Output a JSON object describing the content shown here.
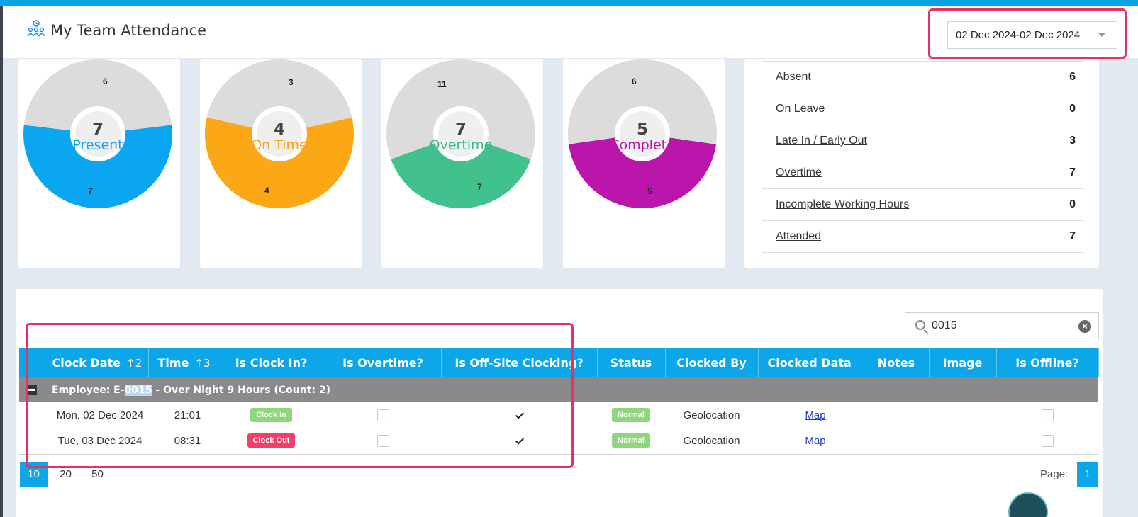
{
  "header": {
    "title": "My Team Attendance",
    "date_range": "02 Dec 2024-02 Dec 2024"
  },
  "donuts": [
    {
      "name": "present",
      "center_value": "7",
      "center_label": "Present",
      "color": "#0aa7f0",
      "segment_value": "7",
      "remainder_value": "6",
      "fraction": 0.538
    },
    {
      "name": "on-time",
      "center_value": "4",
      "center_label": "On Time",
      "color": "#fca816",
      "segment_value": "4",
      "remainder_value": "3",
      "fraction": 0.571
    },
    {
      "name": "overtime",
      "center_value": "7",
      "center_label": "Overtime",
      "color": "#41c18d",
      "segment_value": "7",
      "remainder_value": "11",
      "fraction": 0.389
    },
    {
      "name": "complete",
      "center_value": "5",
      "center_label": "Complete",
      "color": "#bb16ab",
      "segment_value": "5",
      "remainder_value": "6",
      "fraction": 0.455
    }
  ],
  "stats": [
    {
      "label": "Absent",
      "value": "6"
    },
    {
      "label": "On Leave",
      "value": "0"
    },
    {
      "label": "Late In / Early Out",
      "value": "3"
    },
    {
      "label": "Overtime",
      "value": "7"
    },
    {
      "label": "Incomplete Working Hours",
      "value": "0"
    },
    {
      "label": "Attended",
      "value": "7"
    }
  ],
  "search": {
    "value": "0015"
  },
  "grid": {
    "columns": {
      "clock_date": "Clock Date",
      "clock_date_sort": "↑2",
      "time": "Time",
      "time_sort": "↑3",
      "is_clock_in": "Is Clock In?",
      "is_overtime": "Is Overtime?",
      "is_offsite": "Is Off-Site Clocking?",
      "status": "Status",
      "clocked_by": "Clocked By",
      "clocked_data": "Clocked Data",
      "notes": "Notes",
      "image": "Image",
      "is_offline": "Is Offline?"
    },
    "group": {
      "prefix": "Employee: E-",
      "highlight": "0015",
      "suffix": " - Over Night 9 Hours (Count: 2)"
    },
    "rows": [
      {
        "date": "Mon, 02 Dec 2024",
        "time": "21:01",
        "clock": "Clock In",
        "clock_color": "#8fd67c",
        "status": "Normal",
        "clocked_by": "Geolocation",
        "data": "Map"
      },
      {
        "date": "Tue, 03 Dec 2024",
        "time": "08:31",
        "clock": "Clock Out",
        "clock_color": "#f0406a",
        "status": "Normal",
        "clocked_by": "Geolocation",
        "data": "Map"
      }
    ]
  },
  "pager": {
    "sizes": [
      "10",
      "20",
      "50"
    ],
    "page_label": "Page:",
    "page": "1"
  }
}
